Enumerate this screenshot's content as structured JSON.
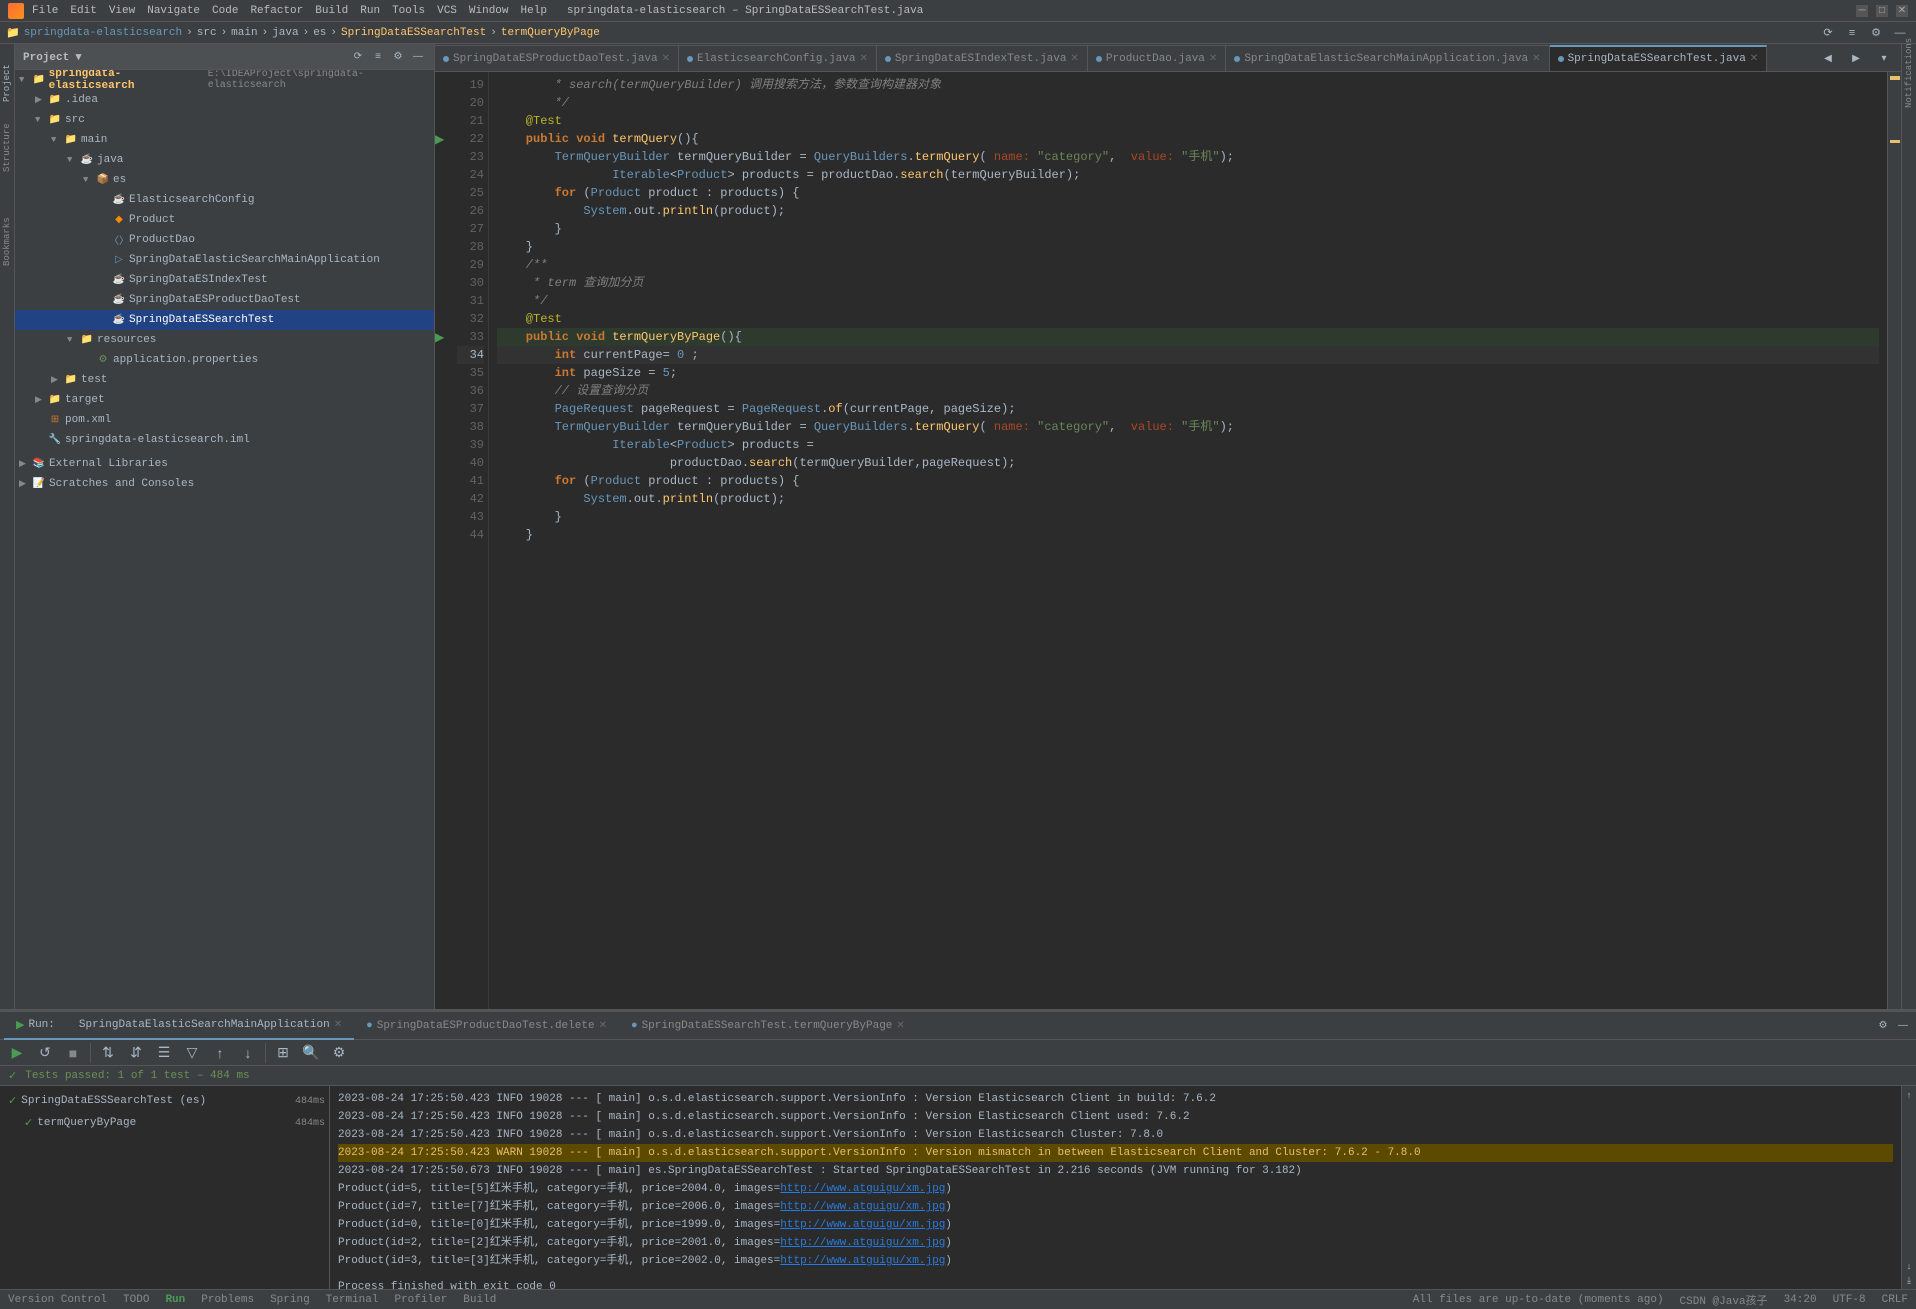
{
  "titleBar": {
    "title": "springdata-elasticsearch – SpringDataESSearchTest.java",
    "menuItems": [
      "File",
      "Edit",
      "View",
      "Navigate",
      "Code",
      "Refactor",
      "Build",
      "Run",
      "Tools",
      "VCS",
      "Window",
      "Help"
    ]
  },
  "breadcrumb": {
    "parts": [
      "springdata-elasticsearch",
      "src",
      "main",
      "java",
      "es",
      "SpringDataESSearchTest",
      "termQueryByPage"
    ]
  },
  "tabs": [
    {
      "label": "SpringDataESProductDaoTest.java",
      "active": false,
      "modified": false
    },
    {
      "label": "ElasticsearchConfig.java",
      "active": false,
      "modified": false
    },
    {
      "label": "SpringDataESIndexTest.java",
      "active": false,
      "modified": false
    },
    {
      "label": "ProductDao.java",
      "active": false,
      "modified": false
    },
    {
      "label": "SpringDataElasticSearchMainApplication.java",
      "active": false,
      "modified": false
    },
    {
      "label": "SpringDataESSearchTest.java",
      "active": true,
      "modified": false
    }
  ],
  "codeLines": [
    {
      "num": 19,
      "content": "        * search(termQueryBuilder) 调用搜索方法，参数查询构建器对象",
      "type": "comment"
    },
    {
      "num": 20,
      "content": "        */",
      "type": "comment"
    },
    {
      "num": 21,
      "content": "    @Test",
      "type": "annotation"
    },
    {
      "num": 22,
      "content": "    public void termQuery(){",
      "type": "code"
    },
    {
      "num": 23,
      "content": "        TermQueryBuilder termQueryBuilder = QueryBuilders.termQuery( name: \"category\",  value: \"手机\");",
      "type": "code"
    },
    {
      "num": 24,
      "content": "                Iterable<Product> products = productDao.search(termQueryBuilder);",
      "type": "code"
    },
    {
      "num": 25,
      "content": "        for (Product product : products) {",
      "type": "code"
    },
    {
      "num": 26,
      "content": "            System.out.println(product);",
      "type": "code"
    },
    {
      "num": 27,
      "content": "        }",
      "type": "code"
    },
    {
      "num": 28,
      "content": "    }",
      "type": "code"
    },
    {
      "num": 29,
      "content": "    /**",
      "type": "comment"
    },
    {
      "num": 30,
      "content": "     * term 查询加分页",
      "type": "comment"
    },
    {
      "num": 31,
      "content": "     */",
      "type": "comment"
    },
    {
      "num": 32,
      "content": "    @Test",
      "type": "annotation"
    },
    {
      "num": 33,
      "content": "    public void termQueryByPage(){",
      "type": "code",
      "hasRunIcon": true
    },
    {
      "num": 34,
      "content": "        int currentPage= 0 ;",
      "type": "code",
      "active": true
    },
    {
      "num": 35,
      "content": "        int pageSize = 5;",
      "type": "code"
    },
    {
      "num": 36,
      "content": "        // 设置查询分页",
      "type": "code_comment"
    },
    {
      "num": 37,
      "content": "        PageRequest pageRequest = PageRequest.of(currentPage, pageSize);",
      "type": "code"
    },
    {
      "num": 38,
      "content": "        TermQueryBuilder termQueryBuilder = QueryBuilders.termQuery( name: \"category\",  value: \"手机\");",
      "type": "code"
    },
    {
      "num": 39,
      "content": "                Iterable<Product> products =",
      "type": "code"
    },
    {
      "num": 40,
      "content": "                        productDao.search(termQueryBuilder,pageRequest);",
      "type": "code"
    },
    {
      "num": 41,
      "content": "        for (Product product : products) {",
      "type": "code"
    },
    {
      "num": 42,
      "content": "            System.out.println(product);",
      "type": "code"
    },
    {
      "num": 43,
      "content": "        }",
      "type": "code"
    },
    {
      "num": 44,
      "content": "    }",
      "type": "code"
    }
  ],
  "projectTree": {
    "title": "Project",
    "root": "springdata-elasticsearch",
    "rootPath": "E:\\IDEAProject\\springdata-elasticsearch",
    "items": [
      {
        "label": ".idea",
        "type": "folder",
        "indent": 1
      },
      {
        "label": "src",
        "type": "folder",
        "indent": 1,
        "expanded": true
      },
      {
        "label": "main",
        "type": "folder",
        "indent": 2,
        "expanded": true
      },
      {
        "label": "java",
        "type": "folder",
        "indent": 3,
        "expanded": true
      },
      {
        "label": "es",
        "type": "folder",
        "indent": 4,
        "expanded": true
      },
      {
        "label": "ElasticsearchConfig",
        "type": "java",
        "indent": 5
      },
      {
        "label": "Product",
        "type": "java",
        "indent": 5
      },
      {
        "label": "ProductDao",
        "type": "java",
        "indent": 5
      },
      {
        "label": "SpringDataElasticSearchMainApplication",
        "type": "java",
        "indent": 5
      },
      {
        "label": "SpringDataESIndexTest",
        "type": "java",
        "indent": 5
      },
      {
        "label": "SpringDataESProductDaoTest",
        "type": "java",
        "indent": 5
      },
      {
        "label": "SpringDataESSearchTest",
        "type": "java",
        "indent": 5,
        "selected": true
      },
      {
        "label": "resources",
        "type": "folder",
        "indent": 3,
        "expanded": true
      },
      {
        "label": "application.properties",
        "type": "properties",
        "indent": 4
      },
      {
        "label": "test",
        "type": "folder",
        "indent": 2
      },
      {
        "label": "target",
        "type": "folder",
        "indent": 1
      },
      {
        "label": "pom.xml",
        "type": "xml",
        "indent": 1
      },
      {
        "label": "springdata-elasticsearch.iml",
        "type": "iml",
        "indent": 1
      }
    ]
  },
  "runPanel": {
    "tabs": [
      {
        "label": "Run:",
        "active": true
      },
      {
        "label": "SpringDataElasticSearchMainApplication",
        "active": true
      },
      {
        "label": "SpringDataESProductDaoTest.delete",
        "active": false
      },
      {
        "label": "SpringDataESSearchTest.termQueryByPage",
        "active": false
      }
    ],
    "statusText": "Tests passed: 1 of 1 test – 484 ms",
    "treeItems": [
      {
        "label": "SpringDataESSSearchTest (es)",
        "time": "484ms",
        "status": "pass"
      },
      {
        "label": "termQueryByPage",
        "time": "484ms",
        "status": "pass",
        "indent": 1
      }
    ],
    "logLines": [
      {
        "type": "info",
        "text": "2023-08-24 17:25:50.423  INFO 19028 --- [          main] o.s.d.elasticsearch.support.VersionInfo  : Version Elasticsearch Client in build: 7.6.2"
      },
      {
        "type": "info",
        "text": "2023-08-24 17:25:50.423  INFO 19028 --- [          main] o.s.d.elasticsearch.support.VersionInfo  : Version Elasticsearch Client used: 7.6.2"
      },
      {
        "type": "info",
        "text": "2023-08-24 17:25:50.423  INFO 19028 --- [          main] o.s.d.elasticsearch.support.VersionInfo  : Version Elasticsearch Cluster: 7.8.0"
      },
      {
        "type": "warn",
        "text": "2023-08-24 17:25:50.423  WARN 19028 --- [          main] o.s.d.elasticsearch.support.VersionInfo  : Version mismatch in between Elasticsearch Client and Cluster: 7.6.2 - 7.8.0"
      },
      {
        "type": "info",
        "text": "2023-08-24 17:25:50.673  INFO 19028 --- [          main] es.SpringDataESSearchTest                : Started SpringDataESSearchTest in 2.216 seconds (JVM running for 3.182)"
      },
      {
        "type": "product",
        "text": "Product(id=5, title=[5]红米手机, category=手机, price=2004.0, images=http://www.atguigu/xm.jpg)"
      },
      {
        "type": "product",
        "text": "Product(id=7, title=[7]红米手机, category=手机, price=2006.0, images=http://www.atguigu/xm.jpg)"
      },
      {
        "type": "product",
        "text": "Product(id=0, title=[0]红米手机, category=手机, price=1999.0, images=http://www.atguigu/xm.jpg)"
      },
      {
        "type": "product",
        "text": "Product(id=2, title=[2]红米手机, category=手机, price=2001.0, images=http://www.atguigu/xm.jpg)"
      },
      {
        "type": "product",
        "text": "Product(id=3, title=[3]红米手机, category=手机, price=2002.0, images=http://www.atguigu/xm.jpg)"
      },
      {
        "type": "finish",
        "text": "Process finished with exit code 0"
      }
    ]
  },
  "statusBar": {
    "left": "All files are up-to-date (moments ago)",
    "gitBranch": "Version Control",
    "todo": "TODO",
    "run": "Run",
    "problems": "Problems",
    "spring": "Spring",
    "terminal": "Terminal",
    "profiler": "Profiler",
    "build": "Build",
    "position": "34:20",
    "encoding": "UTF-8",
    "lineSeparator": "CRLF",
    "rightInfo": "CSDN @Java孩子"
  }
}
